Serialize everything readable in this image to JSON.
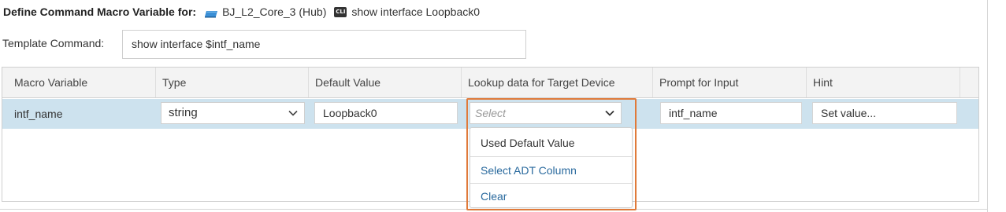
{
  "header": {
    "title": "Define Command Macro Variable for:",
    "device_icon": "device-icon",
    "device_name": "BJ_L2_Core_3 (Hub)",
    "cli_icon": "cli-icon",
    "cli_icon_text": "CLI",
    "cli_command": "show interface Loopback0"
  },
  "template": {
    "label": "Template Command:",
    "value": "show interface $intf_name"
  },
  "grid": {
    "columns": [
      "Macro Variable",
      "Type",
      "Default Value",
      "Lookup data for Target Device",
      "Prompt for Input",
      "Hint"
    ],
    "row": {
      "macro_variable": "intf_name",
      "type": "string",
      "default_value": "Loopback0",
      "lookup_placeholder": "Select",
      "prompt_for_input": "intf_name",
      "hint_placeholder": "Set value..."
    }
  },
  "dropdown": {
    "items": [
      "Used Default Value",
      "Select ADT Column",
      "Clear"
    ]
  },
  "colors": {
    "highlight": "#e07a3a",
    "row_selected": "#cde2ee",
    "link": "#2a6a9e"
  }
}
